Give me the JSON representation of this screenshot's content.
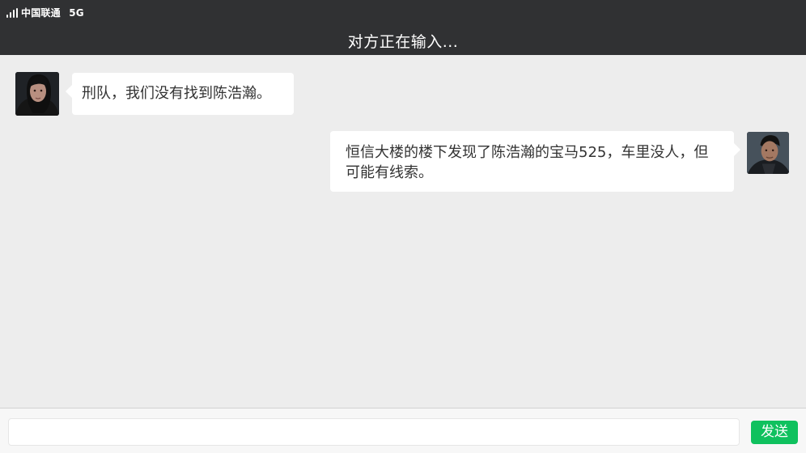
{
  "status_bar": {
    "carrier": "中国联通",
    "network": "5G",
    "signal_icon": "signal-icon"
  },
  "header": {
    "title": "对方正在输入..."
  },
  "messages": [
    {
      "side": "left",
      "text": "刑队，我们没有找到陈浩瀚。",
      "avatar_icon": "female-avatar"
    },
    {
      "side": "right",
      "text": "恒信大楼的楼下发现了陈浩瀚的宝马525，车里没人，但可能有线索。",
      "avatar_icon": "male-avatar"
    }
  ],
  "composer": {
    "input_value": "",
    "input_placeholder": "",
    "send_label": "发送"
  },
  "colors": {
    "header_bg": "#303133",
    "chat_bg": "#ededed",
    "bubble_bg": "#ffffff",
    "send_button": "#0fc15e"
  }
}
